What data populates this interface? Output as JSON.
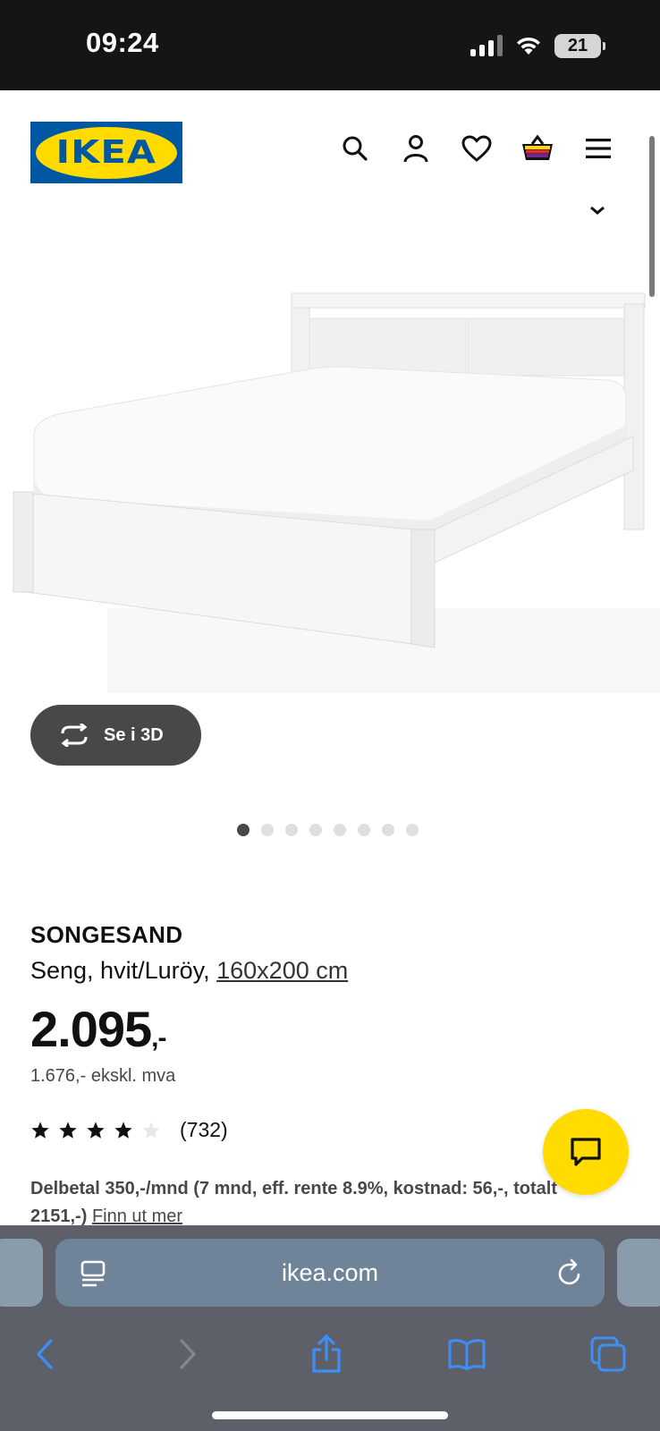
{
  "status_bar": {
    "time": "09:24",
    "battery": "21"
  },
  "header": {
    "logo_text": "IKEA",
    "icons": [
      "search-icon",
      "account-icon",
      "heart-icon",
      "cart-icon",
      "menu-icon"
    ]
  },
  "gallery": {
    "see_3d_label": "Se i 3D",
    "dots_total": 8,
    "active_dot": 0
  },
  "product": {
    "name": "SONGESAND",
    "description_prefix": "Seng, hvit/Luröy, ",
    "size_link": "160x200 cm",
    "price": "2.095",
    "price_suffix": ",-",
    "price_ex_vat": "1.676,- ekskl. mva",
    "rating_stars": 4,
    "rating_count": "(732)",
    "financing_text": "Delbetal 350,-/mnd (7 mnd, eff. rente 8.9%, kostnad: 56,-, totalt 2151,-) ",
    "financing_link": "Finn ut mer"
  },
  "browser": {
    "url": "ikea.com"
  },
  "colors": {
    "ikea_blue": "#0058a3",
    "ikea_yellow": "#ffdb00",
    "chrome": "#5d6068",
    "url_bar": "#6f8499"
  }
}
